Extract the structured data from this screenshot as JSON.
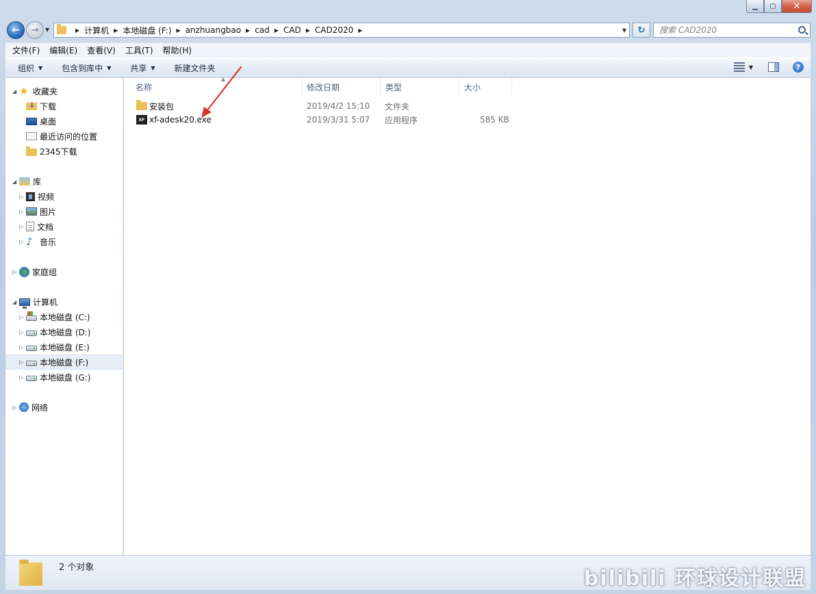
{
  "window": {
    "caption_buttons": [
      "minimize",
      "maximize",
      "close"
    ]
  },
  "address": {
    "crumbs": [
      "计算机",
      "本地磁盘 (F:)",
      "anzhuangbao",
      "cad",
      "CAD",
      "CAD2020"
    ]
  },
  "search": {
    "placeholder": "搜索 CAD2020"
  },
  "menubar": {
    "items": [
      "文件(F)",
      "编辑(E)",
      "查看(V)",
      "工具(T)",
      "帮助(H)"
    ]
  },
  "toolbar": {
    "organize": "组织",
    "include_library": "包含到库中",
    "share": "共享",
    "new_folder": "新建文件夹"
  },
  "navpane": {
    "favorites": "收藏夹",
    "downloads": "下载",
    "desktop": "桌面",
    "recent": "最近访问的位置",
    "download2345": "2345下载",
    "libraries": "库",
    "videos": "视频",
    "pictures": "图片",
    "documents": "文档",
    "music": "音乐",
    "homegroup": "家庭组",
    "computer": "计算机",
    "drive_c": "本地磁盘 (C:)",
    "drive_d": "本地磁盘 (D:)",
    "drive_e": "本地磁盘 (E:)",
    "drive_f": "本地磁盘 (F:)",
    "drive_g": "本地磁盘 (G:)",
    "network": "网络"
  },
  "columns": {
    "name": "名称",
    "date": "修改日期",
    "type": "类型",
    "size": "大小"
  },
  "files": [
    {
      "name": "安装包",
      "date": "2019/4/2 15:10",
      "type": "文件夹",
      "size": "",
      "icon": "folder-icon"
    },
    {
      "name": "xf-adesk20.exe",
      "date": "2019/3/31 5:07",
      "type": "应用程序",
      "size": "585 KB",
      "icon": "exe-icon"
    }
  ],
  "exe_badge": "XF",
  "status": {
    "count": "2 个对象"
  },
  "watermark": "bilibili 环球设计联盟",
  "colors": {
    "accent": "#2f6fc0",
    "annotation_arrow": "#d9342b",
    "folder": "#e9c156"
  }
}
